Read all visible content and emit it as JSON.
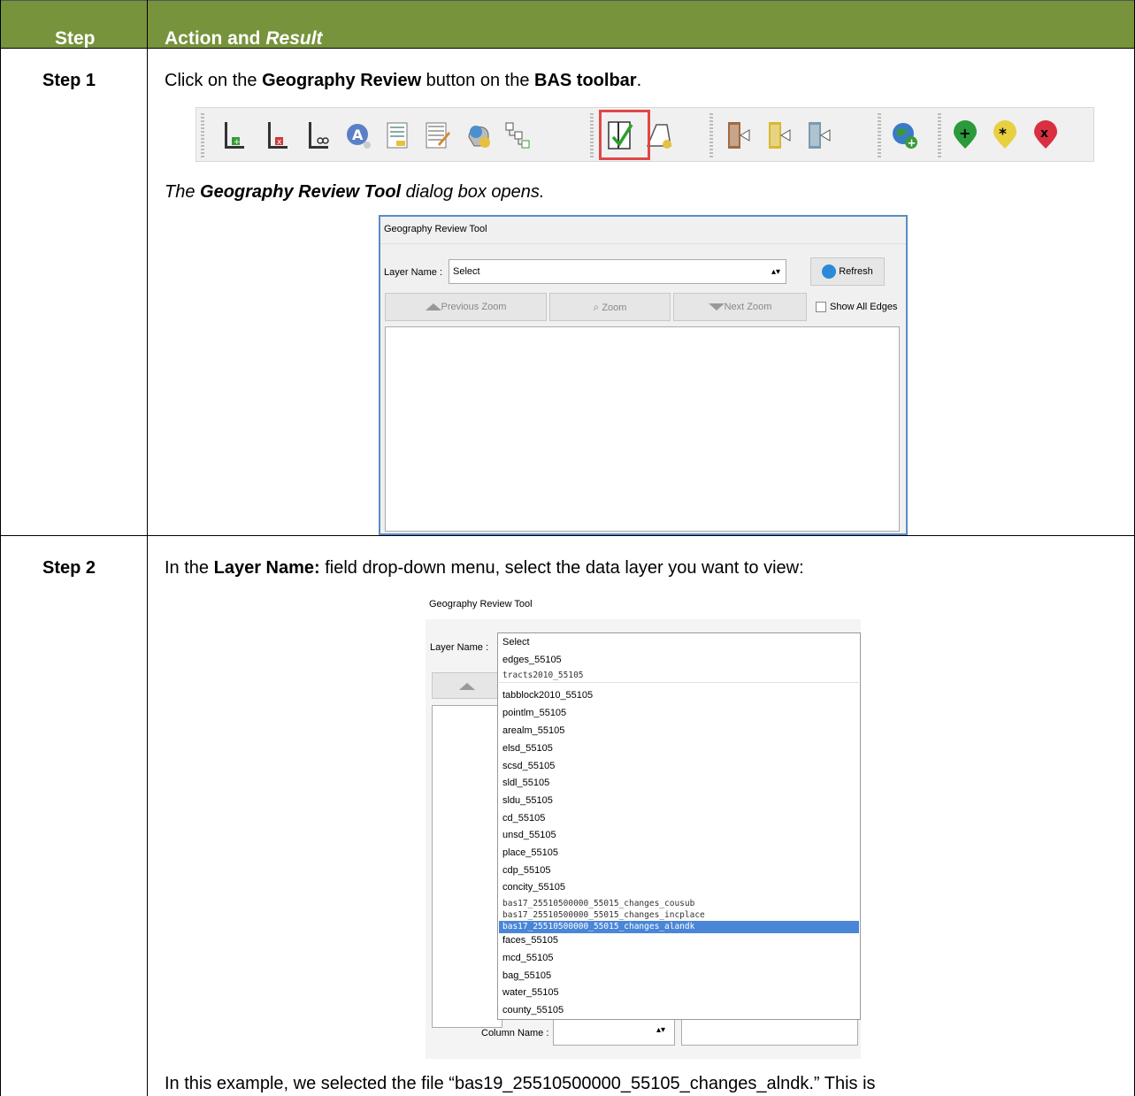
{
  "header": {
    "step": "Step",
    "action": "Action and ",
    "result": "Result"
  },
  "step1": {
    "label": "Step 1",
    "instruction_prefix": "Click on the ",
    "instruction_bold1": "Geography Review",
    "instruction_mid": " button on the ",
    "instruction_bold2": "BAS toolbar",
    "instruction_suffix": ".",
    "result_prefix": "The ",
    "result_bold": "Geography Review Tool",
    "result_suffix": " dialog box opens.",
    "toolbar_icons": [
      "add-line-icon",
      "delete-line-icon",
      "split-line-icon",
      "address-icon",
      "form-icon",
      "table-icon",
      "globe-head-icon",
      "hierarchy-icon",
      "geography-review-icon",
      "polygon-icon",
      "import-icon",
      "export-icon",
      "export-alt-icon",
      "add-globe-icon",
      "add-point-icon",
      "star-point-icon",
      "remove-point-icon"
    ]
  },
  "dialog1": {
    "title": "Geography Review Tool",
    "layer_label": "Layer Name :",
    "layer_value": "Select",
    "refresh": "Refresh",
    "prev_zoom": "Previous Zoom",
    "zoom": "Zoom",
    "next_zoom": "Next Zoom",
    "show_all_edges": "Show All Edges"
  },
  "step2": {
    "label": "Step 2",
    "instruction_prefix": "In the ",
    "instruction_bold": "Layer Name:",
    "instruction_suffix": " field drop-down menu, select the data layer you want to view:",
    "footer": "In this example, we selected the file “bas19_25510500000_55105_changes_alndk.” This is"
  },
  "dialog2": {
    "title": "Geography Review Tool",
    "layer_label": "Layer Name :",
    "column_label": "Column Name :",
    "options": [
      "Select",
      "edges_55105",
      "tracts2010_55105",
      "tabblock2010_55105",
      "pointlm_55105",
      "arealm_55105",
      "elsd_55105",
      "scsd_55105",
      "sldl_55105",
      "sldu_55105",
      "cd_55105",
      "unsd_55105",
      "place_55105",
      "cdp_55105",
      "concity_55105",
      "bas17_25510500000_55015_changes_cousub",
      "bas17_25510500000_55015_changes_incplace",
      "bas17_25510500000_55015_changes_alandk",
      "faces_55105",
      "mcd_55105",
      "bag_55105",
      "water_55105",
      "county_55105"
    ],
    "selected_option": "bas17_25510500000_55015_changes_alandk"
  },
  "colors": {
    "header_bg": "#77933c",
    "highlight": "#e04848",
    "selection": "#4a86d8"
  }
}
